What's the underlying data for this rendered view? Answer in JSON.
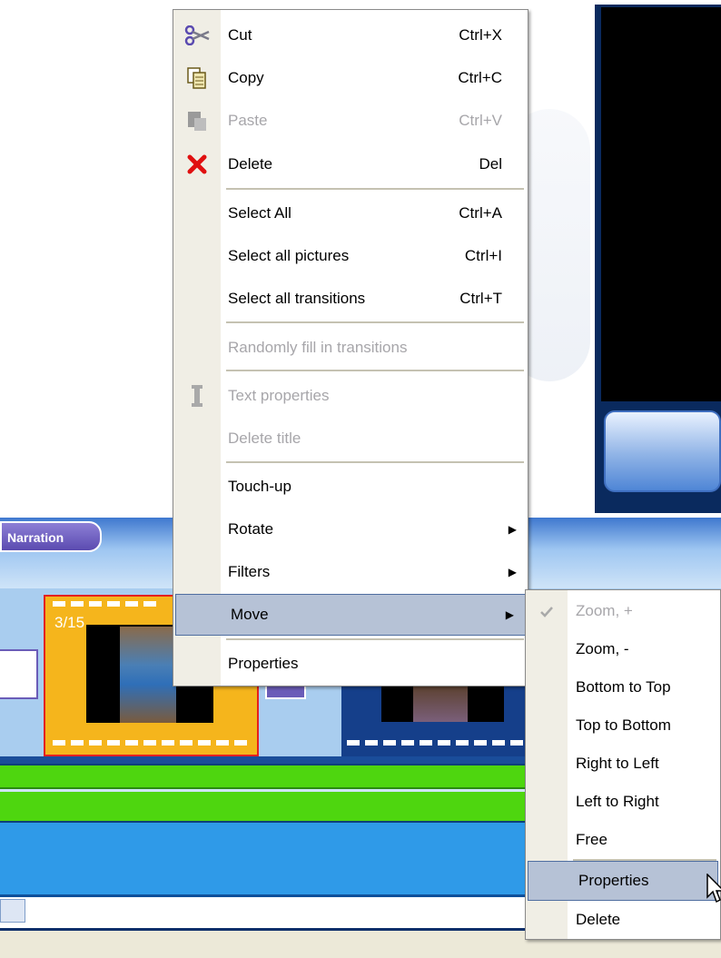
{
  "timeline": {
    "narration_tab": "Narration",
    "clip_number": "3/15"
  },
  "main_menu": {
    "items": [
      {
        "label": "Cut",
        "shortcut": "Ctrl+X",
        "icon": "scissors-icon",
        "disabled": false
      },
      {
        "label": "Copy",
        "shortcut": "Ctrl+C",
        "icon": "copy-icon",
        "disabled": false
      },
      {
        "label": "Paste",
        "shortcut": "Ctrl+V",
        "icon": "paste-icon",
        "disabled": true
      },
      {
        "label": "Delete",
        "shortcut": "Del",
        "icon": "delete-x-icon",
        "disabled": false
      },
      {
        "label": "Select All",
        "shortcut": "Ctrl+A",
        "disabled": false
      },
      {
        "label": "Select all pictures",
        "shortcut": "Ctrl+I",
        "disabled": false
      },
      {
        "label": "Select all transitions",
        "shortcut": "Ctrl+T",
        "disabled": false
      },
      {
        "label": "Randomly fill in transitions",
        "shortcut": "",
        "disabled": true
      },
      {
        "label": "Text properties",
        "shortcut": "",
        "icon": "text-cursor-icon",
        "disabled": true
      },
      {
        "label": "Delete title",
        "shortcut": "",
        "disabled": true
      },
      {
        "label": "Touch-up",
        "shortcut": "",
        "disabled": false
      },
      {
        "label": "Rotate",
        "shortcut": "",
        "submenu": true,
        "disabled": false
      },
      {
        "label": "Filters",
        "shortcut": "",
        "submenu": true,
        "disabled": false
      },
      {
        "label": "Move",
        "shortcut": "",
        "submenu": true,
        "highlighted": true,
        "disabled": false
      },
      {
        "label": "Properties",
        "shortcut": "",
        "disabled": false
      }
    ]
  },
  "move_submenu": {
    "items": [
      {
        "label": "Zoom, +",
        "checked": true,
        "disabled": true
      },
      {
        "label": "Zoom, -",
        "disabled": false
      },
      {
        "label": "Bottom to Top",
        "disabled": false
      },
      {
        "label": "Top to Bottom",
        "disabled": false
      },
      {
        "label": "Right to Left",
        "disabled": false
      },
      {
        "label": "Left to Right",
        "disabled": false
      },
      {
        "label": "Free",
        "disabled": false
      },
      {
        "label": "Properties",
        "highlighted": true,
        "disabled": false
      },
      {
        "label": "Delete",
        "disabled": false
      }
    ]
  },
  "colors": {
    "menu_highlight": "#b6c2d6",
    "disabled_text": "#a7a6aa",
    "delete_icon_red": "#e01010",
    "timeline_green": "#4ed60f",
    "clip_selected_fill": "#f5b51c"
  }
}
